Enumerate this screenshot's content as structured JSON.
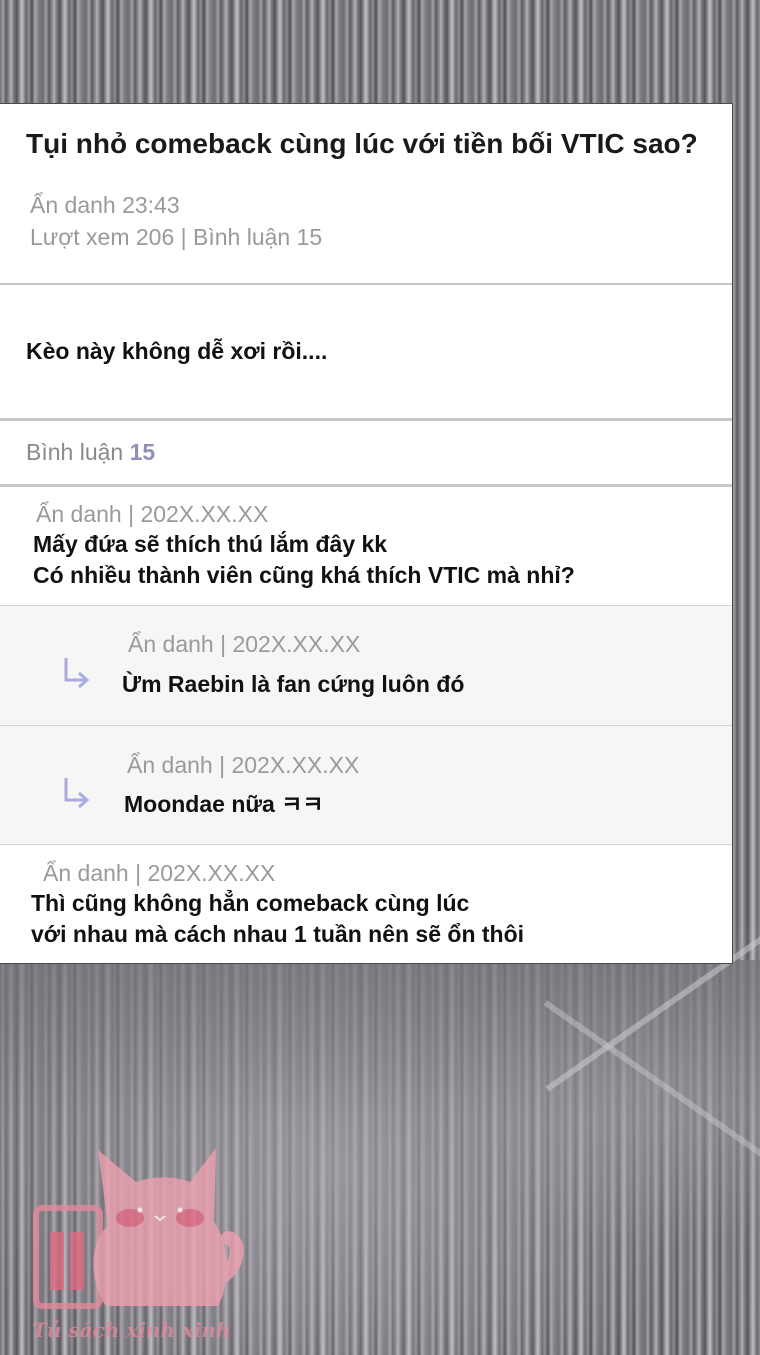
{
  "post": {
    "title": "Tụi nhỏ comeback cùng lúc với tiền bối VTIC sao?",
    "author_time": "Ẩn danh 23:43",
    "stats": "Lượt xem 206 | Bình luận 15",
    "body": "Kèo này không dễ xơi rồi...."
  },
  "comments_header": {
    "label": "Bình luận",
    "count": "15"
  },
  "comments": [
    {
      "meta": "Ẩn danh | 202X.XX.XX",
      "line1": "Mấy đứa sẽ thích thú lắm đây kk",
      "line2": "Có nhiều thành viên cũng khá thích VTIC mà nhỉ?"
    },
    {
      "meta": "Ẩn danh | 202X.XX.XX",
      "line1": "Ừm Raebin là fan cứng luôn đó",
      "icon": "reply-arrow-icon"
    },
    {
      "meta": "Ẩn danh | 202X.XX.XX",
      "line1": "Moondae nữa ㅋㅋ",
      "icon": "reply-arrow-icon"
    },
    {
      "meta": "Ẩn danh | 202X.XX.XX",
      "line1": "Thì cũng không hẳn comeback cùng lúc",
      "line2": "với nhau mà cách nhau 1 tuần nên sẽ ổn thôi"
    }
  ],
  "watermark": {
    "text": "Tủ sách xinh xinh",
    "icon": "cat-mascot-icon",
    "color": "#e8889a"
  },
  "colors": {
    "accent": "#8f90b8",
    "meta_text": "#9a9a9a",
    "reply_arrow": "#a9aade"
  }
}
